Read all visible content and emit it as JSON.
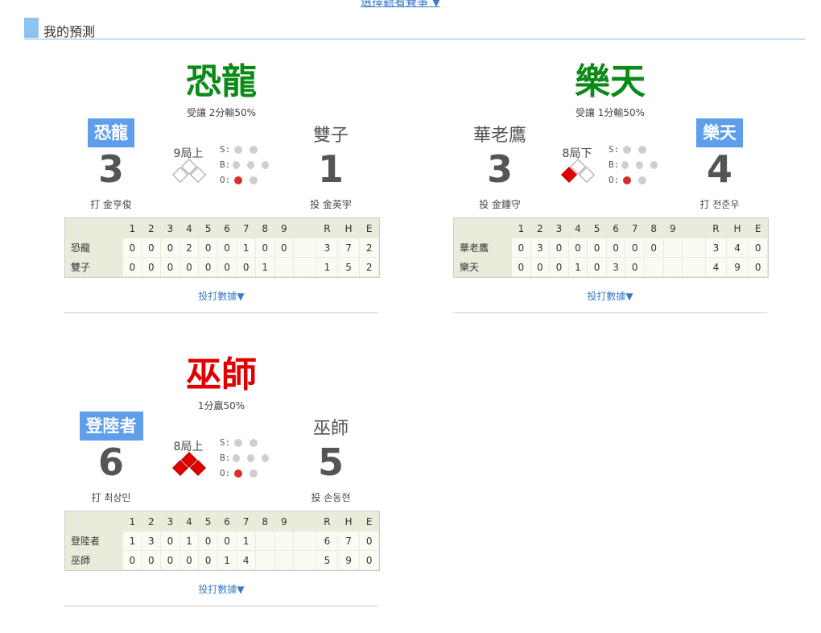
{
  "top_link": "選擇觀看賽事 ▼",
  "section": {
    "title": "我的預測"
  },
  "stats_link_label": "投打數據▼",
  "columns": [
    "1",
    "2",
    "3",
    "4",
    "5",
    "6",
    "7",
    "8",
    "9",
    "R",
    "H",
    "E"
  ],
  "games": [
    {
      "pick": "恐龍",
      "pick_color": "#0c8a18",
      "odds": "受讓 2分輸50%",
      "inning": "9局上",
      "away": {
        "name": "恐龍",
        "score": "3",
        "player": "打 金亨俊",
        "batting": true
      },
      "home": {
        "name": "雙子",
        "score": "1",
        "player": "投 金英宇",
        "batting": false
      },
      "count": {
        "strikes": 2,
        "balls": 3,
        "outs": 2,
        "outs_filled": 1
      },
      "bases": {
        "first": false,
        "second": false,
        "third": false
      },
      "line": [
        {
          "team": "恐龍",
          "innings": [
            "0",
            "0",
            "0",
            "2",
            "0",
            "0",
            "1",
            "0",
            "0"
          ],
          "r": "3",
          "h": "7",
          "e": "2"
        },
        {
          "team": "雙子",
          "innings": [
            "0",
            "0",
            "0",
            "0",
            "0",
            "0",
            "0",
            "1",
            ""
          ],
          "r": "1",
          "h": "5",
          "e": "2"
        }
      ]
    },
    {
      "pick": "樂天",
      "pick_color": "#0c8a18",
      "odds": "受讓 1分輸50%",
      "inning": "8局下",
      "away": {
        "name": "華老鷹",
        "score": "3",
        "player": "投 金鍾守",
        "batting": false
      },
      "home": {
        "name": "樂天",
        "score": "4",
        "player": "打 전준우",
        "batting": true
      },
      "count": {
        "strikes": 2,
        "balls": 3,
        "outs": 2,
        "outs_filled": 1
      },
      "bases": {
        "first": false,
        "second": false,
        "third": true
      },
      "line": [
        {
          "team": "華老鷹",
          "innings": [
            "0",
            "3",
            "0",
            "0",
            "0",
            "0",
            "0",
            "0",
            ""
          ],
          "r": "3",
          "h": "4",
          "e": "0"
        },
        {
          "team": "樂天",
          "innings": [
            "0",
            "0",
            "0",
            "1",
            "0",
            "3",
            "0",
            "",
            ""
          ],
          "r": "4",
          "h": "9",
          "e": "0"
        }
      ]
    },
    {
      "pick": "巫師",
      "pick_color": "#e00000",
      "odds": "1分贏50%",
      "inning": "8局上",
      "away": {
        "name": "登陸者",
        "score": "6",
        "player": "打 최상민",
        "batting": true
      },
      "home": {
        "name": "巫師",
        "score": "5",
        "player": "投 손동현",
        "batting": false
      },
      "count": {
        "strikes": 2,
        "balls": 3,
        "outs": 2,
        "outs_filled": 1
      },
      "bases": {
        "first": true,
        "second": true,
        "third": true
      },
      "line": [
        {
          "team": "登陸者",
          "innings": [
            "1",
            "3",
            "0",
            "1",
            "0",
            "0",
            "1",
            "",
            ""
          ],
          "r": "6",
          "h": "7",
          "e": "0"
        },
        {
          "team": "巫師",
          "innings": [
            "0",
            "0",
            "0",
            "0",
            "0",
            "1",
            "4",
            "",
            ""
          ],
          "r": "5",
          "h": "9",
          "e": "0"
        }
      ]
    }
  ]
}
